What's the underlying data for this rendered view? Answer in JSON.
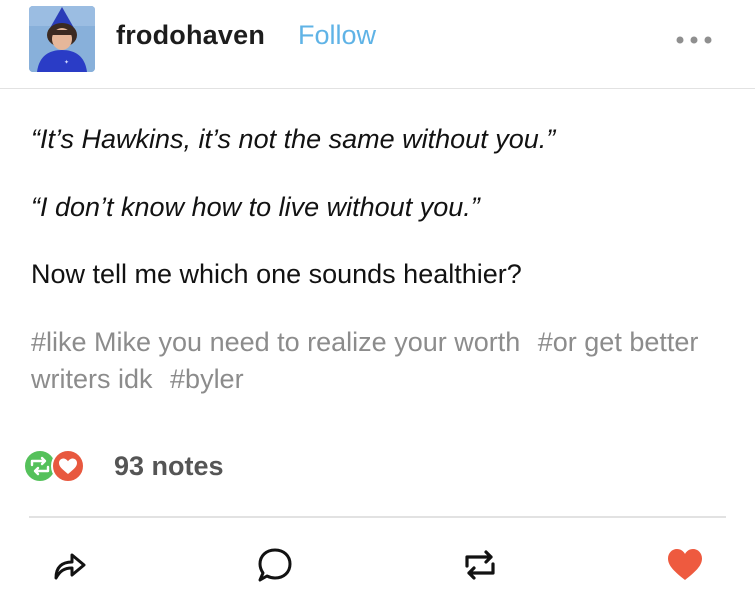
{
  "post": {
    "username": "frodohaven",
    "follow_label": "Follow",
    "more_icon": "ellipsis-icon",
    "quote_1": "“It’s Hawkins, it’s not the same without you.”",
    "quote_2": "“I don’t know how to live without you.”",
    "text_3": "Now tell me which one sounds healthier?",
    "tags": [
      "#like Mike you need to realize your worth",
      "#or get better writers idk",
      "#byler"
    ],
    "notes_count": "93 notes"
  },
  "actions": {
    "share_icon": "share-icon",
    "reply_icon": "reply-icon",
    "reblog_icon": "reblog-icon",
    "like_icon": "heart-icon"
  },
  "colors": {
    "follow": "#5fb3e6",
    "reblog_badge": "#55c15b",
    "like_badge": "#e8583f",
    "like_heart": "#ee5a3f"
  }
}
